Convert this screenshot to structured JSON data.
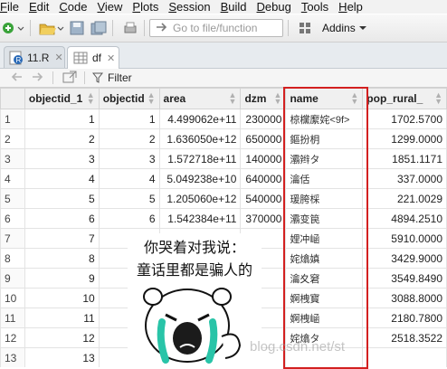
{
  "menu": [
    {
      "label": "File",
      "u": "F",
      "rest": "ile"
    },
    {
      "label": "Edit",
      "u": "E",
      "rest": "dit"
    },
    {
      "label": "Code",
      "u": "C",
      "rest": "ode"
    },
    {
      "label": "View",
      "u": "V",
      "rest": "iew"
    },
    {
      "label": "Plots",
      "u": "P",
      "rest": "lots"
    },
    {
      "label": "Session",
      "u": "S",
      "rest": "ession"
    },
    {
      "label": "Build",
      "u": "B",
      "rest": "uild"
    },
    {
      "label": "Debug",
      "u": "D",
      "rest": "ebug"
    },
    {
      "label": "Tools",
      "u": "T",
      "rest": "ools"
    },
    {
      "label": "Help",
      "u": "H",
      "rest": "elp"
    }
  ],
  "toolbar": {
    "goto_placeholder": "Go to file/function",
    "addins_label": "Addins"
  },
  "tabs": [
    {
      "label": "11.R",
      "active": false
    },
    {
      "label": "df",
      "active": true
    }
  ],
  "viewbar": {
    "filter_label": "Filter"
  },
  "table": {
    "columns": [
      "",
      "objectid_1",
      "objectid",
      "area",
      "dzm",
      "name",
      "pop_rural_"
    ],
    "rows": [
      [
        "1",
        "1",
        "1",
        "4.499062e+11",
        "230000",
        "椋欓緳姹<9f>",
        "1702.5700"
      ],
      [
        "2",
        "2",
        "2",
        "1.636050e+12",
        "650000",
        "鏂扮枂",
        "1299.0000"
      ],
      [
        "3",
        "3",
        "3",
        "1.572718e+11",
        "140000",
        "灞辫タ",
        "1851.1171"
      ],
      [
        "4",
        "4",
        "4",
        "5.049238e+10",
        "640000",
        "瀹佸",
        "337.0000"
      ],
      [
        "5",
        "5",
        "5",
        "1.205060e+12",
        "540000",
        "瑗胯棌",
        "221.0029"
      ],
      [
        "6",
        "6",
        "6",
        "1.542384e+11",
        "370000",
        "灞变笢",
        "4894.2510"
      ],
      [
        "7",
        "7",
        "",
        "",
        "",
        "娌冲崡",
        "5910.0000"
      ],
      [
        "8",
        "8",
        "",
        "",
        "",
        "姹熻嫃",
        "3429.9000"
      ],
      [
        "9",
        "9",
        "",
        "",
        "",
        "瀹夊窘",
        "3549.8490"
      ],
      [
        "10",
        "10",
        "",
        "",
        "",
        "婀栧寳",
        "3088.8000"
      ],
      [
        "11",
        "11",
        "",
        "",
        "",
        "婀栧崡",
        "2180.7800"
      ],
      [
        "12",
        "12",
        "",
        "",
        "",
        "姹熻タ",
        "2518.3522"
      ],
      [
        "13",
        "13",
        "",
        "",
        "",
        "",
        ""
      ]
    ]
  },
  "meme": {
    "line1": "你哭着对我说：",
    "line2": "童话里都是骗人的"
  },
  "watermark": "blog.csdn.net/st",
  "colors": {
    "highlight": "#d32020",
    "header_bg": "#f0f0f0",
    "tab_strip": "#e7ebef"
  }
}
